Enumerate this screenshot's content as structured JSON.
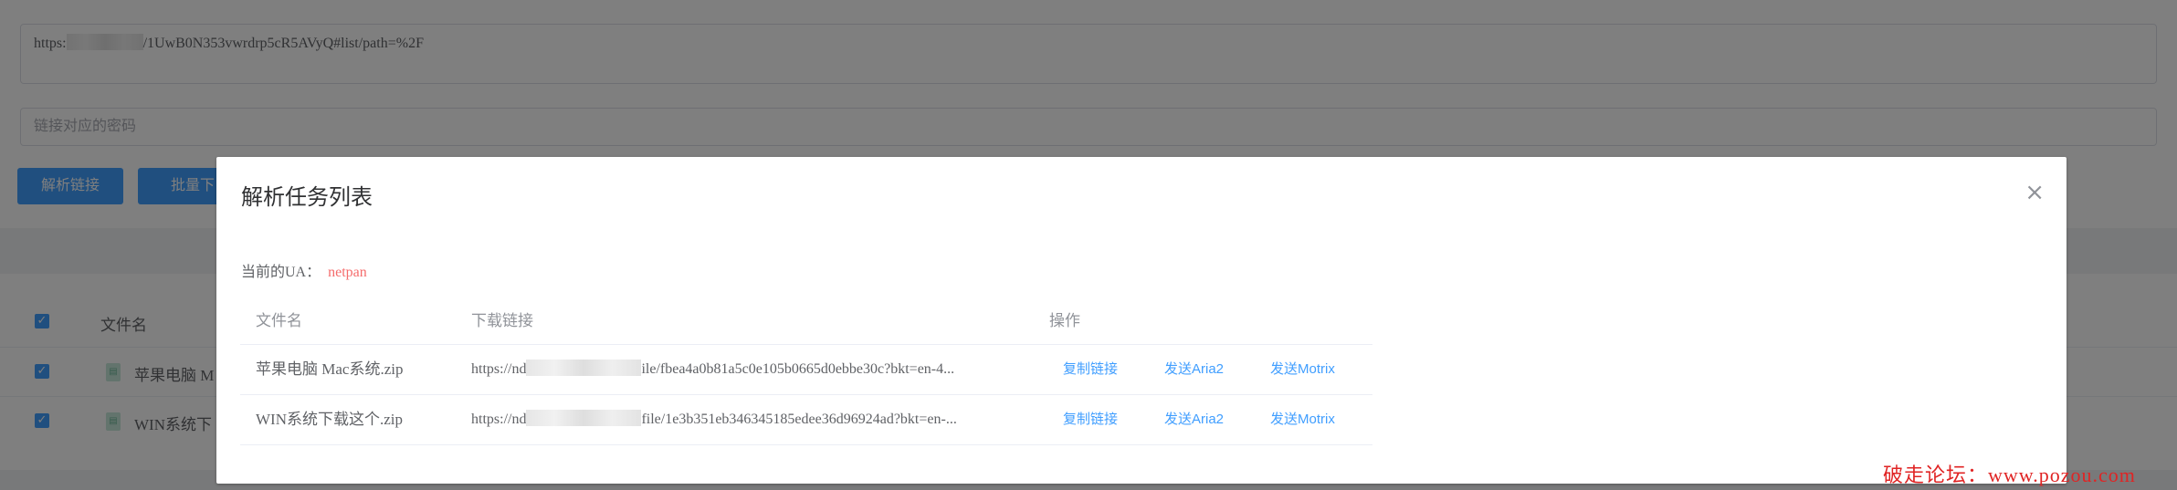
{
  "background": {
    "url_input": {
      "prefix": "https:",
      "suffix": "/1UwB0N353vwrdrp5cR5AVyQ#list/path=%2F"
    },
    "password_input": {
      "placeholder": "链接对应的密码"
    },
    "buttons": {
      "parse": "解析链接",
      "batch_partial": "批量下"
    },
    "file_list": {
      "header_filename": "文件名",
      "rows": [
        {
          "name_partial": "苹果电脑 M"
        },
        {
          "name_partial": "WIN系统下"
        }
      ]
    }
  },
  "dialog": {
    "title": "解析任务列表",
    "close_icon": "close-icon",
    "ua_label": "当前的UA：",
    "ua_value": "netpan",
    "table": {
      "headers": {
        "filename": "文件名",
        "download_link": "下载链接",
        "actions": "操作"
      },
      "rows": [
        {
          "filename": "苹果电脑 Mac系统.zip",
          "link_prefix": "https://nd",
          "link_suffix": "ile/fbea4a0b81a5c0e105b0665d0ebbe30c?bkt=en-4...",
          "copy": "复制链接",
          "aria2": "发送Aria2",
          "motrix": "发送Motrix"
        },
        {
          "filename": "WIN系统下载这个.zip",
          "link_prefix": "https://nd",
          "link_suffix": "file/1e3b351eb346345185edee36d96924ad?bkt=en-...",
          "copy": "复制链接",
          "aria2": "发送Aria2",
          "motrix": "发送Motrix"
        }
      ]
    }
  },
  "watermark": "破走论坛：www.pozou.com",
  "colors": {
    "primary": "#409eff",
    "ua_value": "#f56c6c",
    "watermark": "#e02424",
    "overlay": "rgba(0,0,0,0.5)"
  }
}
